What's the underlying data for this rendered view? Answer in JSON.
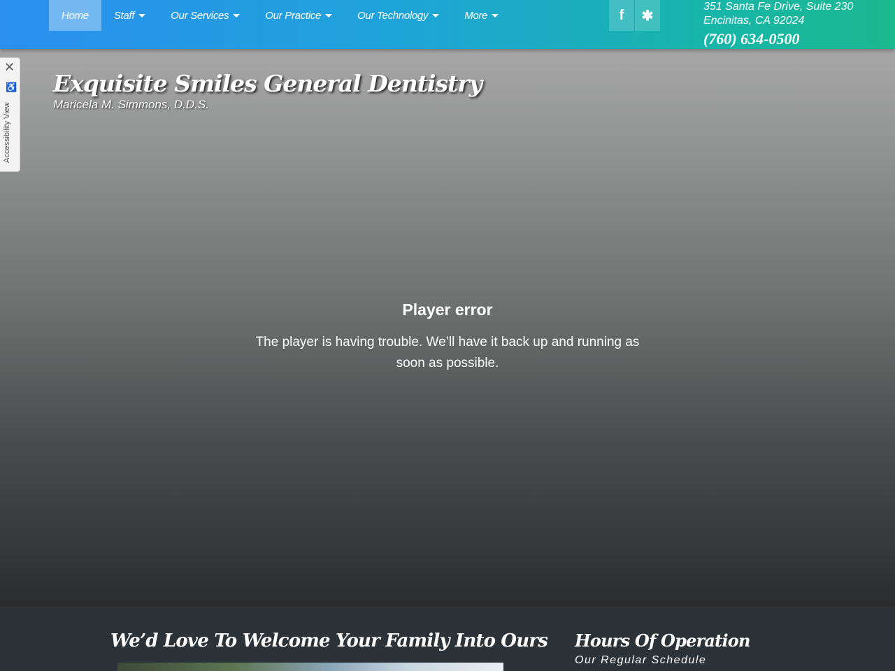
{
  "nav": {
    "items": [
      {
        "label": "Home",
        "active": true,
        "dropdown": false
      },
      {
        "label": "Staff",
        "active": false,
        "dropdown": true
      },
      {
        "label": "Our Services",
        "active": false,
        "dropdown": true
      },
      {
        "label": "Our Practice",
        "active": false,
        "dropdown": true
      },
      {
        "label": "Our Technology",
        "active": false,
        "dropdown": true
      },
      {
        "label": "More",
        "active": false,
        "dropdown": true
      }
    ]
  },
  "social": {
    "facebook_glyph": "f",
    "yelp_glyph": "✱"
  },
  "contact": {
    "address_line1": "351 Santa Fe Drive, Suite 230",
    "address_line2": "Encinitas, CA 92024",
    "phone": "(760) 634-0500"
  },
  "hero": {
    "title": "Exquisite Smiles General Dentistry",
    "subtitle": "Maricela M. Simmons, D.D.S.",
    "player_error_title": "Player error",
    "player_error_message": "The player is having trouble. We’ll have it back up and running as soon as possible."
  },
  "accessibility": {
    "label": "Accessibility View",
    "close_glyph": "✕",
    "icon_glyph": "♿"
  },
  "bottom": {
    "welcome_heading": "We’d Love To Welcome Your Family Into Ours",
    "hours_heading": "Hours Of Operation",
    "hours_subheading": "Our Regular Schedule"
  },
  "colors": {
    "gradient_start": "#2b8ff0",
    "gradient_end": "#1ab98f",
    "footer_bg": "#2c3338"
  }
}
